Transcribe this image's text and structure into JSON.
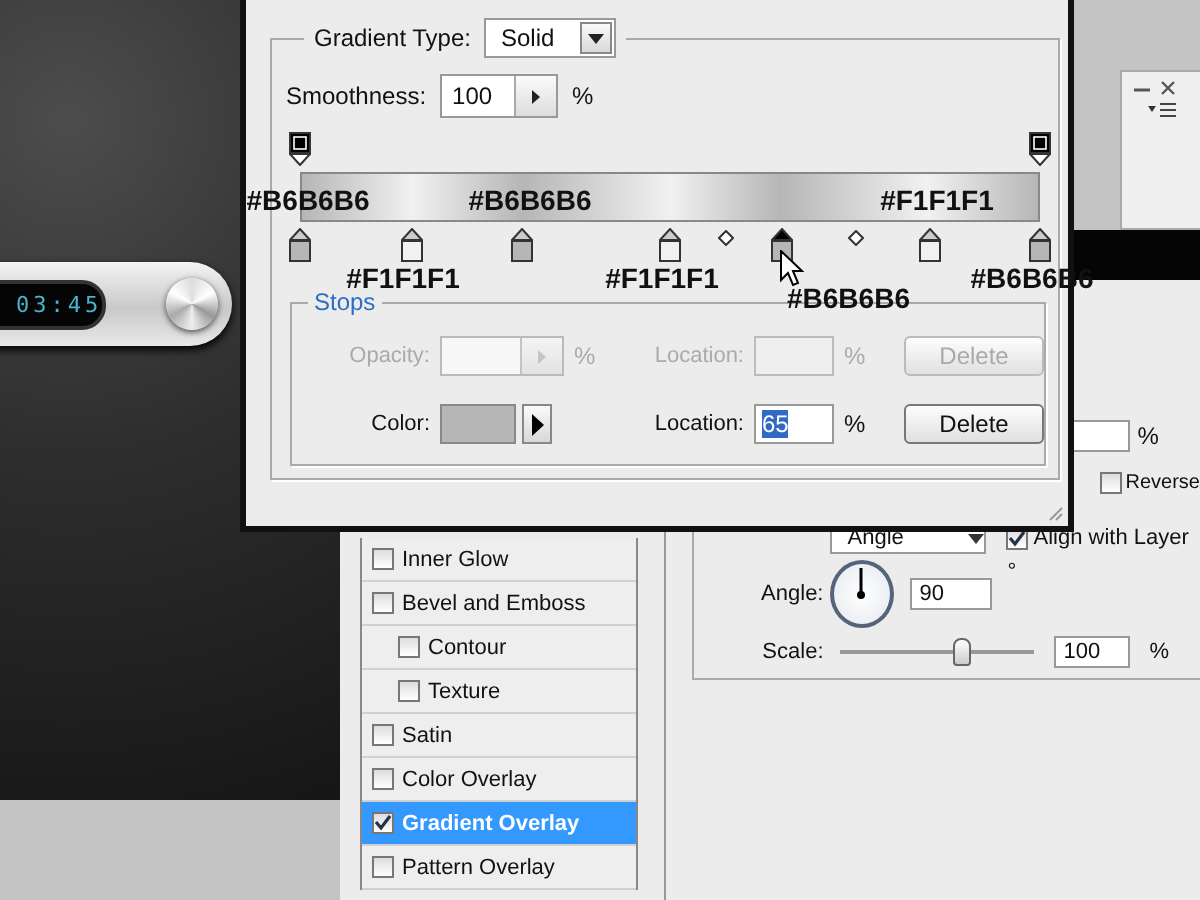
{
  "canvas": {
    "display_time": "03:45"
  },
  "gradient_editor": {
    "gradient_type_label": "Gradient Type:",
    "gradient_type": "Solid",
    "smoothness_label": "Smoothness:",
    "smoothness": "100",
    "smoothness_unit": "%",
    "opacity_stops": [
      {
        "level": 0,
        "selected": false
      },
      {
        "level": 1,
        "selected": false
      }
    ],
    "color_stops": [
      {
        "level": 0,
        "color": "#b6b6b6",
        "label": "#B6B6B6",
        "kind": "bar",
        "selected": false
      },
      {
        "level": 0.15,
        "color": "#f1f1f1",
        "label": "#F1F1F1",
        "kind": "below",
        "selected": false
      },
      {
        "level": 0.3,
        "color": "#b6b6b6",
        "label": "#B6B6B6",
        "kind": "bar",
        "selected": false
      },
      {
        "level": 0.5,
        "color": "#f1f1f1",
        "label": "#F1F1F1",
        "kind": "below",
        "selected": false
      },
      {
        "level": 0.65,
        "color": "#b6b6b6",
        "label": "#B6B6B6",
        "kind": "below-right",
        "selected": true
      },
      {
        "level": 0.85,
        "color": "#f1f1f1",
        "label": "#F1F1F1",
        "kind": "bar",
        "selected": false
      },
      {
        "level": 1,
        "color": "#b6b6b6",
        "label": "#B6B6B6",
        "kind": "below",
        "selected": false
      }
    ],
    "midpoints": [
      {
        "level": 0.575
      },
      {
        "level": 0.75
      }
    ],
    "stops_panel": {
      "title": "Stops",
      "rows": [
        {
          "kind": "opacity",
          "label": "Opacity:",
          "unit": "%",
          "location_label": "Location:",
          "location_unit": "%",
          "delete_label": "Delete",
          "disabled": true
        },
        {
          "kind": "color",
          "label": "Color:",
          "color": "#b6b6b6",
          "location_label": "Location:",
          "location_value": "65",
          "value_selected": true,
          "location_unit": "%",
          "delete_label": "Delete",
          "disabled": false
        }
      ]
    }
  },
  "layer_style": {
    "effects": [
      {
        "label": "Inner Glow",
        "checked": false,
        "selected": false
      },
      {
        "label": "Bevel and Emboss",
        "checked": false,
        "selected": false,
        "children": [
          {
            "label": "Contour",
            "checked": false,
            "selected": false
          },
          {
            "label": "Texture",
            "checked": false,
            "selected": false
          }
        ]
      },
      {
        "label": "Satin",
        "checked": false,
        "selected": false
      },
      {
        "label": "Color Overlay",
        "checked": false,
        "selected": false
      },
      {
        "label": "Gradient Overlay",
        "checked": true,
        "selected": true
      },
      {
        "label": "Pattern Overlay",
        "checked": false,
        "selected": false
      }
    ],
    "gradient_overlay": {
      "opacity_unit": "%",
      "reverse_label": "Reverse",
      "reverse_checked": false,
      "style_value": "Angle",
      "align_label": "Align with Layer",
      "align_checked": true,
      "angle_label": "Angle:",
      "angle_value": "90",
      "angle_unit": "°",
      "scale_label": "Scale:",
      "scale_slider": {
        "level": 0.63
      },
      "scale_value": "100",
      "scale_unit": "%"
    }
  }
}
